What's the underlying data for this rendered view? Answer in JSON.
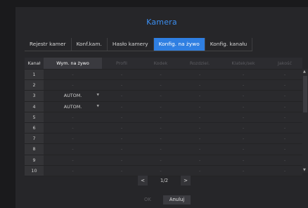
{
  "window": {
    "title": "Kamera"
  },
  "tabs": [
    {
      "label": "Rejestr kamer",
      "active": false
    },
    {
      "label": "Konf.kam.",
      "active": false
    },
    {
      "label": "Hasło kamery",
      "active": false
    },
    {
      "label": "Konfig. na żywo",
      "active": true
    },
    {
      "label": "Konfig. kanału",
      "active": false
    }
  ],
  "table": {
    "headers": [
      "Kanał",
      "Wym. na żywo",
      "Profil",
      "Kodek",
      "Rozdziel.",
      "Klatek/sek",
      "Jakość"
    ],
    "rows": [
      [
        "1",
        "-",
        "-",
        "-",
        "-",
        "-",
        "-"
      ],
      [
        "2",
        "-",
        "-",
        "-",
        "-",
        "-",
        "-"
      ],
      [
        "3",
        "AUTOM.",
        "-",
        "-",
        "-",
        "-",
        "-"
      ],
      [
        "4",
        "AUTOM.",
        "-",
        "-",
        "-",
        "-",
        "-"
      ],
      [
        "5",
        "-",
        "-",
        "-",
        "-",
        "-",
        "-"
      ],
      [
        "6",
        "-",
        "-",
        "-",
        "-",
        "-",
        "-"
      ],
      [
        "7",
        "-",
        "-",
        "-",
        "-",
        "-",
        "-"
      ],
      [
        "8",
        "-",
        "-",
        "-",
        "-",
        "-",
        "-"
      ],
      [
        "9",
        "-",
        "-",
        "-",
        "-",
        "-",
        "-"
      ],
      [
        "10",
        "-",
        "-",
        "-",
        "-",
        "-",
        "-"
      ]
    ]
  },
  "pager": {
    "prev": "<",
    "next": ">",
    "page": "1/2"
  },
  "footer": {
    "ok_label": "OK",
    "cancel_label": "Anuluj"
  },
  "colors": {
    "accent": "#2f7fe2",
    "title": "#3b8ef0",
    "background": "#262629"
  }
}
